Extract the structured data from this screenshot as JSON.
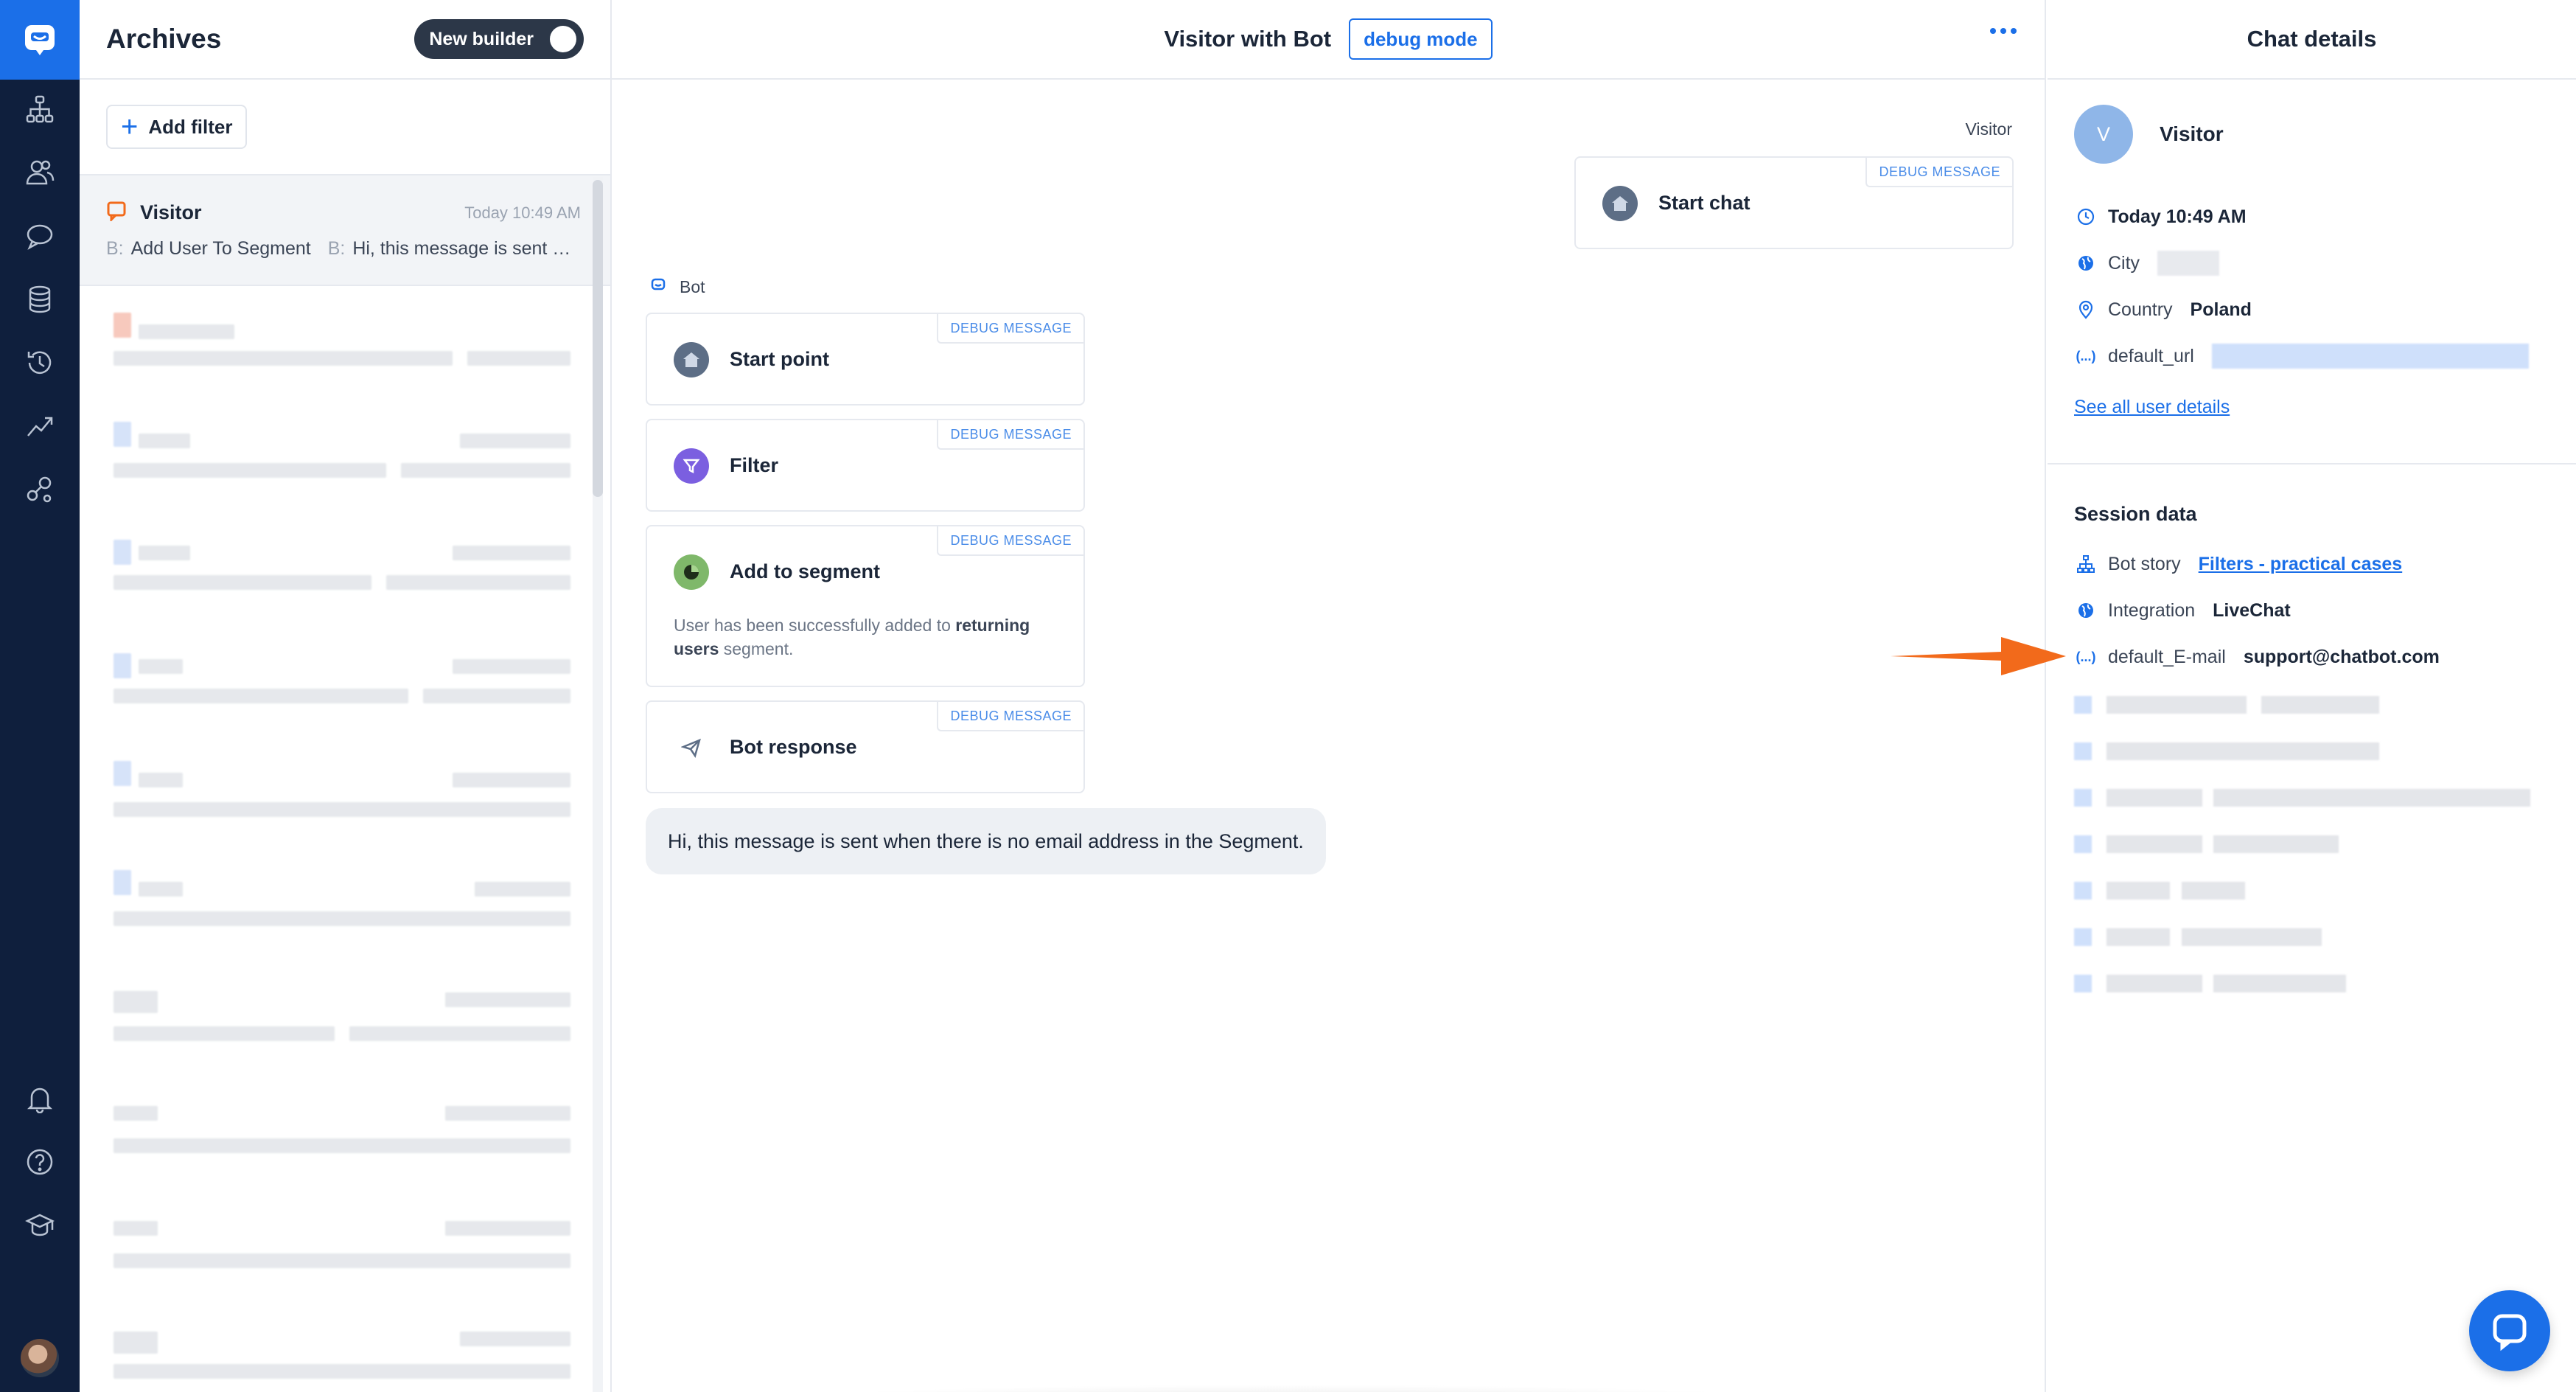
{
  "rail": {
    "items": [
      "org-chart-icon",
      "users-icon",
      "chat-icon",
      "database-icon",
      "history-icon",
      "trend-icon",
      "integrations-icon"
    ],
    "bottom": [
      "bell-icon",
      "help-icon",
      "academy-icon"
    ]
  },
  "archives": {
    "title": "Archives",
    "builder_toggle": "New builder",
    "add_filter": "Add filter",
    "active_conversation": {
      "name": "Visitor",
      "time": "Today 10:49 AM",
      "prefix1": "B:",
      "text1": "Add User To Segment",
      "prefix2": "B:",
      "text2": "Hi, this message is sent …"
    }
  },
  "chat": {
    "title": "Visitor with Bot",
    "debug_button": "debug mode",
    "visitor_label": "Visitor",
    "bot_label": "Bot",
    "debug_tag": "DEBUG MESSAGE",
    "visitor_card": {
      "title": "Start chat"
    },
    "bot_cards": [
      {
        "title": "Start point"
      },
      {
        "title": "Filter"
      },
      {
        "title": "Add to segment",
        "desc_a": "User has been successfully added to ",
        "desc_b": "returning users",
        "desc_c": " segment."
      },
      {
        "title": "Bot response"
      }
    ],
    "bubble": "Hi, this message is sent when there is no email address in the Segment."
  },
  "details": {
    "title": "Chat details",
    "visitor_initial": "V",
    "visitor_name": "Visitor",
    "time": "Today 10:49 AM",
    "city_label": "City",
    "country_label": "Country",
    "country_value": "Poland",
    "url_label": "default_url",
    "see_all": "See all user details",
    "session_title": "Session data",
    "bot_story_label": "Bot story",
    "bot_story_value": "Filters - practical cases",
    "integration_label": "Integration",
    "integration_value": "LiveChat",
    "email_label": "default_E-mail",
    "email_value": "support@chatbot.com"
  },
  "colors": {
    "accent": "#1b6fe8",
    "rail": "#0f1f3d",
    "arrow": "#f26a1b"
  }
}
